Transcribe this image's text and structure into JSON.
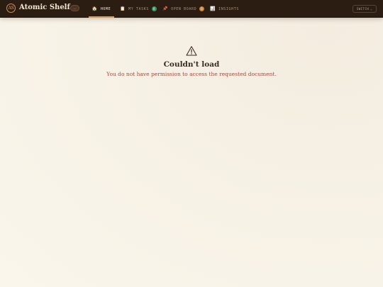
{
  "brand": {
    "initials": "AS",
    "name": "Atomic Shelf",
    "env_label": "—"
  },
  "nav": [
    {
      "label": "HOME",
      "icon": "home-icon",
      "glyph": "🏠",
      "active": true
    },
    {
      "label": "MY TASKS",
      "icon": "clipboard-icon",
      "glyph": "📋",
      "count": "0",
      "count_color": "#2f9a63"
    },
    {
      "label": "OPEN BOARD",
      "icon": "pin-icon",
      "glyph": "📌",
      "count": "0",
      "count_color": "#c8833a"
    },
    {
      "label": "INSIGHTS",
      "icon": "chart-icon",
      "glyph": "📊"
    }
  ],
  "switch": {
    "label": "SWITCH",
    "icon": "chevron-down-icon"
  },
  "error": {
    "icon": "warning-icon",
    "title": "Couldn't load",
    "message": "You do not have permission to access the requested document."
  },
  "colors": {
    "topbar": "#2c1d12",
    "accent": "#d39a5c",
    "error_text": "#b8423a",
    "title_text": "#3a2a1e"
  }
}
